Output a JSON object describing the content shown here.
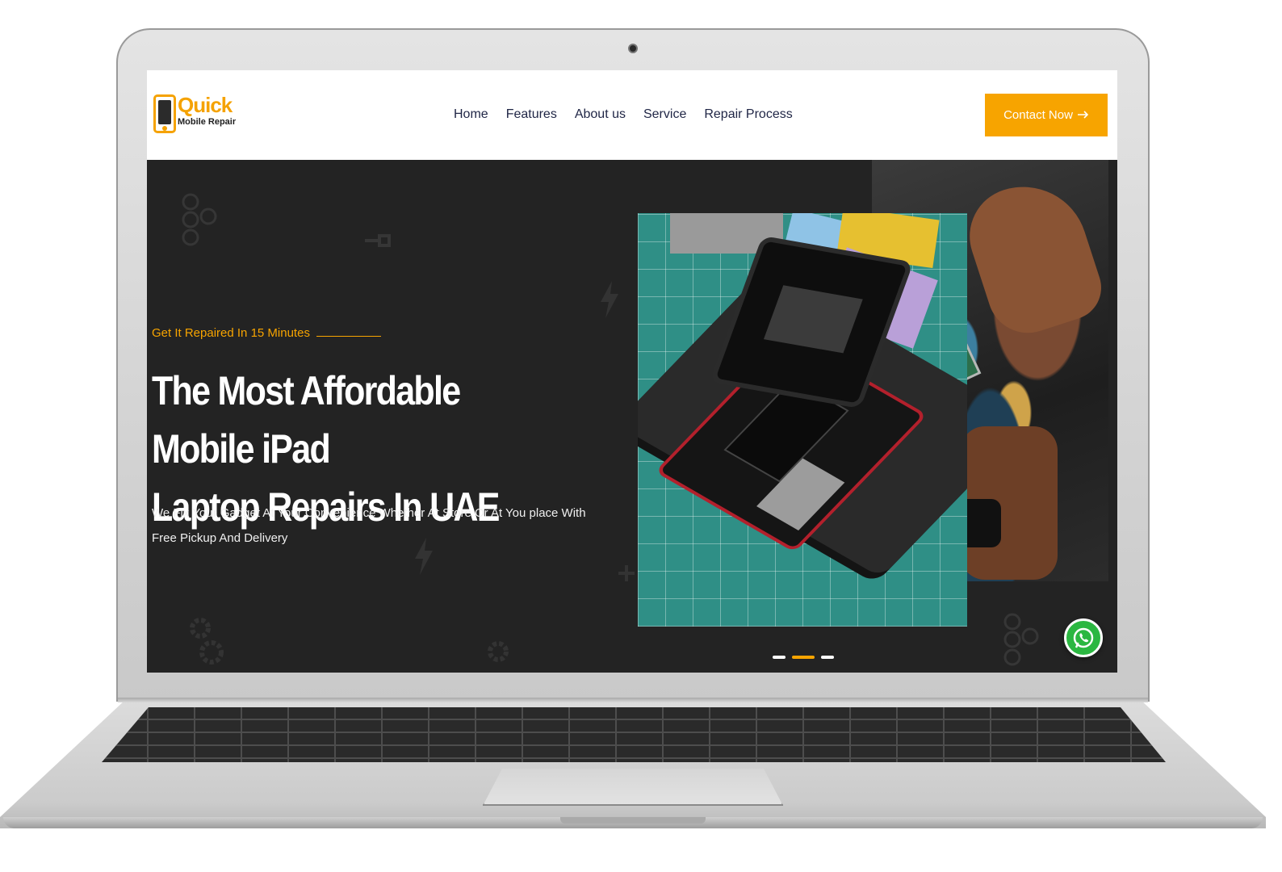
{
  "brand": {
    "name": "Quick",
    "tagline": "Mobile Repair",
    "accent_color": "#f7a400"
  },
  "nav": {
    "items": [
      {
        "label": "Home"
      },
      {
        "label": "Features"
      },
      {
        "label": "About us"
      },
      {
        "label": "Service"
      },
      {
        "label": "Repair Process"
      }
    ]
  },
  "header": {
    "cta_label": "Contact Now",
    "cta_icon": "arrow-right-icon"
  },
  "hero": {
    "eyebrow": "Get It Repaired In 15 Minutes",
    "title_line1": "The Most Affordable Mobile iPad",
    "title_line2": "Laptop Repairs In UAE",
    "description": "We Fix Your Gadget At Your Convenience Whether At Store Or At You place With Free Pickup And Delivery",
    "background_color": "#232323"
  },
  "slider": {
    "total_slides": 3,
    "active_slide": 2
  },
  "floating": {
    "whatsapp_icon": "whatsapp-icon",
    "whatsapp_color": "#2bb741"
  }
}
